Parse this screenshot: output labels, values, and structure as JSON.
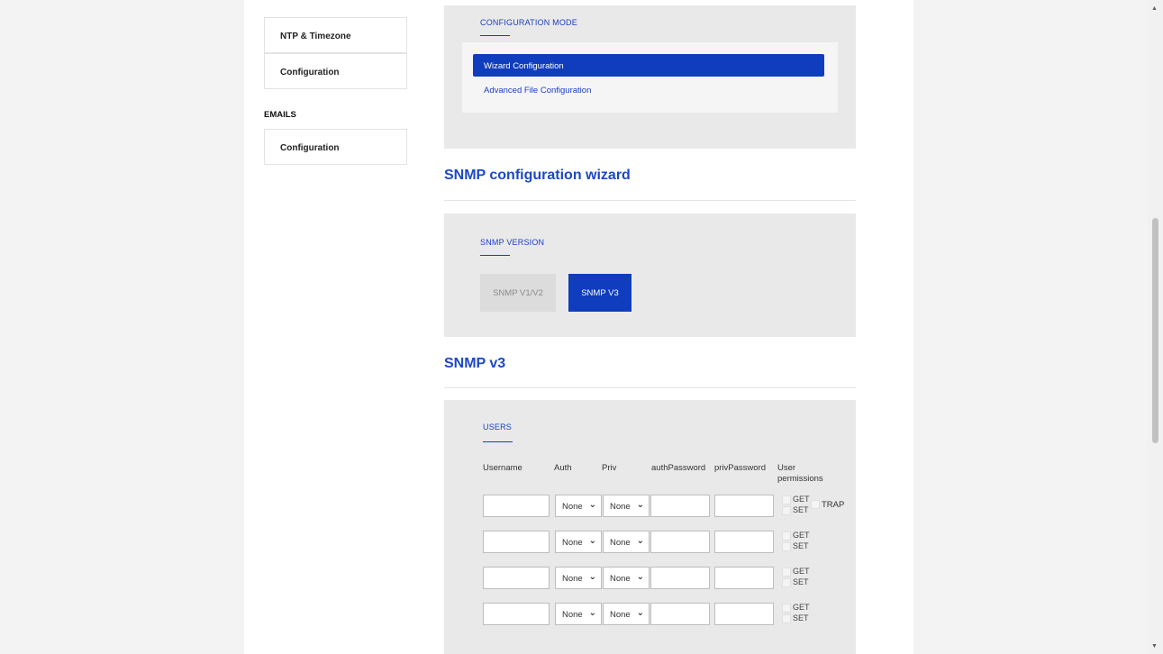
{
  "sidebar": {
    "cards_top": [
      {
        "label": "NTP & Timezone"
      },
      {
        "label": "Configuration"
      }
    ],
    "emails_heading": "EMAILS",
    "emails_cards": [
      {
        "label": "Configuration"
      }
    ]
  },
  "config_mode": {
    "label": "CONFIGURATION MODE",
    "items": [
      {
        "label": "Wizard Configuration",
        "active": true
      },
      {
        "label": "Advanced File Configuration",
        "active": false
      }
    ]
  },
  "wizard": {
    "title": "SNMP configuration wizard",
    "version_label": "SNMP VERSION",
    "versions": [
      {
        "label": "SNMP V1/V2",
        "active": false
      },
      {
        "label": "SNMP V3",
        "active": true
      }
    ]
  },
  "snmpv3": {
    "title": "SNMP v3",
    "users_label": "USERS",
    "columns": {
      "username": "Username",
      "auth": "Auth",
      "priv": "Priv",
      "auth_password": "authPassword",
      "priv_password": "privPassword",
      "user_permissions_1": "User",
      "user_permissions_2": "permissions"
    },
    "rows": [
      {
        "username": "",
        "auth": "None",
        "priv": "None",
        "auth_password": "",
        "priv_password": "",
        "get": "GET",
        "set": "SET",
        "trap": "TRAP"
      },
      {
        "username": "",
        "auth": "None",
        "priv": "None",
        "auth_password": "",
        "priv_password": "",
        "get": "GET",
        "set": "SET"
      },
      {
        "username": "",
        "auth": "None",
        "priv": "None",
        "auth_password": "",
        "priv_password": "",
        "get": "GET",
        "set": "SET"
      },
      {
        "username": "",
        "auth": "None",
        "priv": "None",
        "auth_password": "",
        "priv_password": "",
        "get": "GET",
        "set": "SET"
      }
    ]
  },
  "colors": {
    "accent": "#0f3dbd",
    "title_blue": "#1d48c4",
    "panel_bg": "#e9e9e9"
  }
}
